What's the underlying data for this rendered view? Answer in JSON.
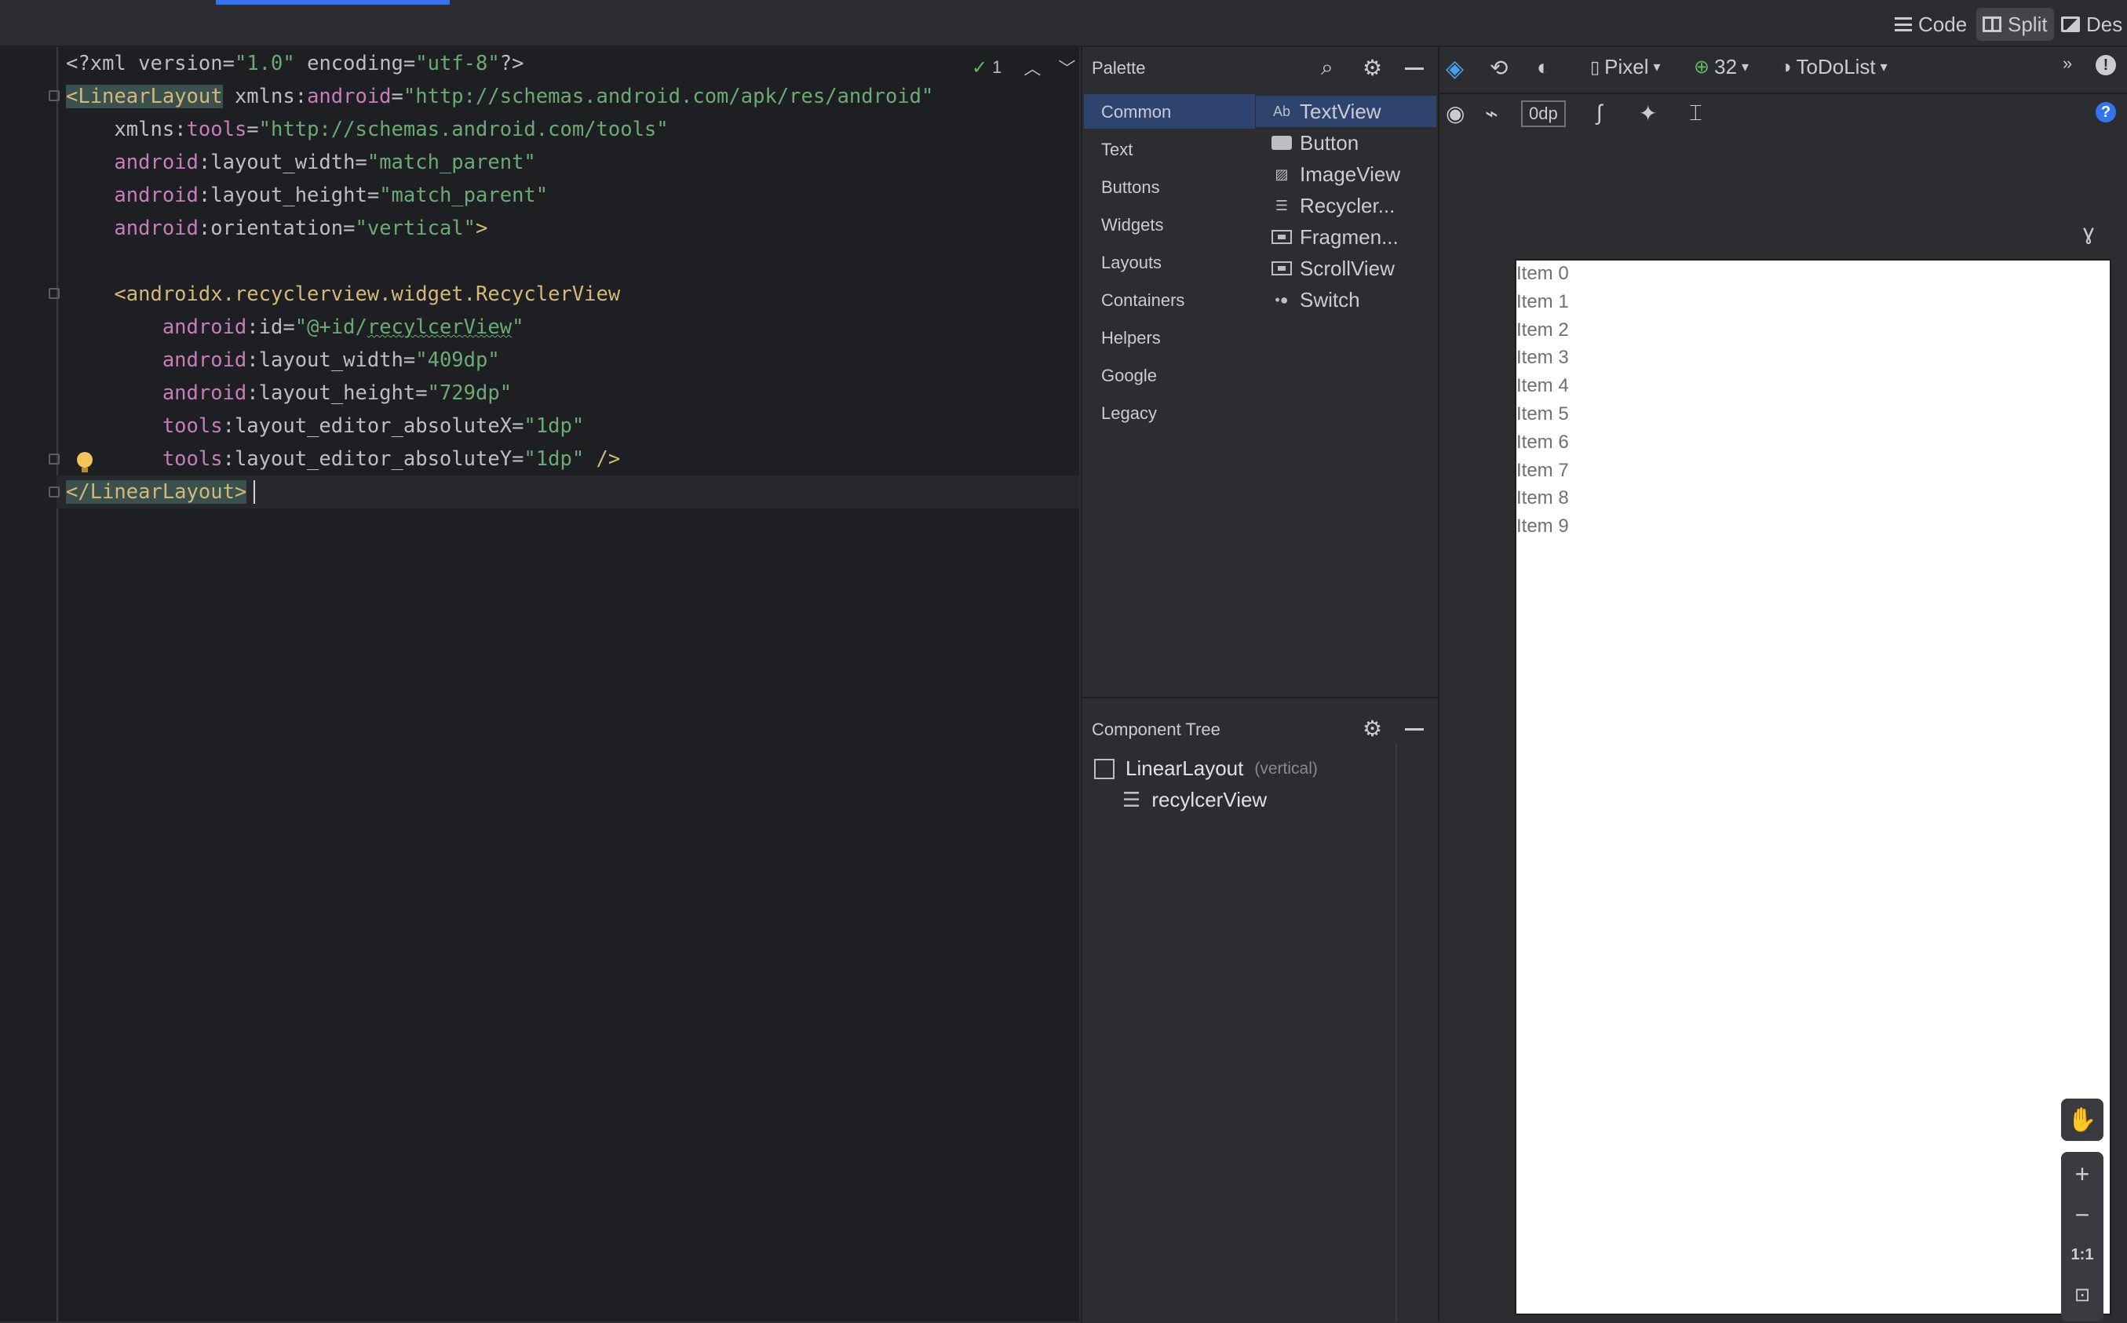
{
  "view_modes": {
    "code": "Code",
    "split": "Split",
    "design": "Des"
  },
  "editor": {
    "inspection_count": "1",
    "lines": [
      {
        "parts": [
          [
            "tx",
            "<?"
          ],
          [
            "at",
            "xml version"
          ],
          [
            "tx",
            "="
          ],
          [
            "vl",
            "\"1.0\""
          ],
          [
            "at",
            " encoding"
          ],
          [
            "tx",
            "="
          ],
          [
            "vl",
            "\"utf-8\""
          ],
          [
            "tx",
            "?>"
          ]
        ]
      },
      {
        "parts": [
          [
            "tg-hl",
            "<LinearLayout"
          ],
          [
            "at",
            " xmlns:"
          ],
          [
            "ns",
            "android"
          ],
          [
            "tx",
            "="
          ],
          [
            "vl",
            "\"http://schemas.android.com/apk/res/android\""
          ]
        ]
      },
      {
        "parts": [
          [
            "at",
            "    xmlns:"
          ],
          [
            "ns",
            "tools"
          ],
          [
            "tx",
            "="
          ],
          [
            "vl",
            "\"http://schemas.android.com/tools\""
          ]
        ]
      },
      {
        "parts": [
          [
            "ns",
            "    android"
          ],
          [
            "at",
            ":layout_width"
          ],
          [
            "tx",
            "="
          ],
          [
            "vl",
            "\"match_parent\""
          ]
        ]
      },
      {
        "parts": [
          [
            "ns",
            "    android"
          ],
          [
            "at",
            ":layout_height"
          ],
          [
            "tx",
            "="
          ],
          [
            "vl",
            "\"match_parent\""
          ]
        ]
      },
      {
        "parts": [
          [
            "ns",
            "    android"
          ],
          [
            "at",
            ":orientation"
          ],
          [
            "tx",
            "="
          ],
          [
            "vl",
            "\"vertical\""
          ],
          [
            "tg",
            ">"
          ]
        ]
      },
      {
        "parts": []
      },
      {
        "parts": [
          [
            "tg",
            "    <androidx.recyclerview.widget.RecyclerView"
          ]
        ]
      },
      {
        "parts": [
          [
            "ns",
            "        android"
          ],
          [
            "at",
            ":id"
          ],
          [
            "tx",
            "="
          ],
          [
            "vl",
            "\"@+id/"
          ],
          [
            "vl und",
            "recylcerView"
          ],
          [
            "vl",
            "\""
          ]
        ]
      },
      {
        "parts": [
          [
            "ns",
            "        android"
          ],
          [
            "at",
            ":layout_width"
          ],
          [
            "tx",
            "="
          ],
          [
            "vl",
            "\"409dp\""
          ]
        ]
      },
      {
        "parts": [
          [
            "ns",
            "        android"
          ],
          [
            "at",
            ":layout_height"
          ],
          [
            "tx",
            "="
          ],
          [
            "vl",
            "\"729dp\""
          ]
        ]
      },
      {
        "parts": [
          [
            "ns",
            "        tools"
          ],
          [
            "at",
            ":layout_editor_absoluteX"
          ],
          [
            "tx",
            "="
          ],
          [
            "vl",
            "\"1dp\""
          ]
        ]
      },
      {
        "parts": [
          [
            "ns",
            "        tools"
          ],
          [
            "at",
            ":layout_editor_absoluteY"
          ],
          [
            "tx",
            "="
          ],
          [
            "vl",
            "\"1dp\""
          ],
          [
            "tg",
            " />"
          ]
        ]
      },
      {
        "parts": [
          [
            "tg-hl",
            "</LinearLayout>"
          ]
        ]
      }
    ]
  },
  "palette": {
    "title": "Palette",
    "categories": [
      "Common",
      "Text",
      "Buttons",
      "Widgets",
      "Layouts",
      "Containers",
      "Helpers",
      "Google",
      "Legacy"
    ],
    "items": [
      {
        "label": "TextView",
        "icon": "textview-icon",
        "glyph": "Ab"
      },
      {
        "label": "Button",
        "icon": "button-icon",
        "glyph": ""
      },
      {
        "label": "ImageView",
        "icon": "imageview-icon",
        "glyph": "▨"
      },
      {
        "label": "Recycler...",
        "icon": "recyclerview-icon",
        "glyph": "☰"
      },
      {
        "label": "Fragmen...",
        "icon": "fragment-icon",
        "glyph": ""
      },
      {
        "label": "ScrollView",
        "icon": "scrollview-icon",
        "glyph": ""
      },
      {
        "label": "Switch",
        "icon": "switch-icon",
        "glyph": "•●"
      }
    ]
  },
  "component_tree": {
    "title": "Component Tree",
    "root": {
      "label": "LinearLayout",
      "hint": "(vertical)"
    },
    "child": {
      "label": "recylcerView"
    }
  },
  "design_toolbar": {
    "device": "Pixel",
    "api": "32",
    "theme": "ToDoList",
    "margin": "0dp"
  },
  "preview": {
    "items": [
      "Item 0",
      "Item 1",
      "Item 2",
      "Item 3",
      "Item 4",
      "Item 5",
      "Item 6",
      "Item 7",
      "Item 8",
      "Item 9"
    ]
  },
  "zoom": {
    "plus": "+",
    "minus": "−",
    "one_to_one": "1:1"
  }
}
